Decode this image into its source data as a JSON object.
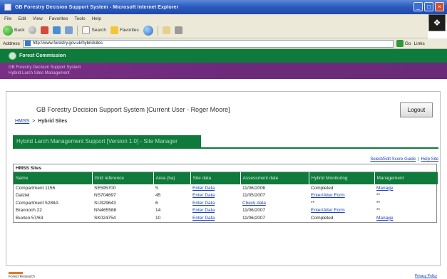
{
  "window": {
    "title": "GB Forestry Decision Support System - Microsoft Internet Explorer",
    "controls": [
      "_",
      "□",
      "×"
    ]
  },
  "menu": [
    "File",
    "Edit",
    "View",
    "Favorites",
    "Tools",
    "Help"
  ],
  "toolbar": {
    "back_label": "Back",
    "search_label": "Search",
    "favorites_label": "Favorites"
  },
  "address": {
    "label": "Address",
    "url": "http://www.forestry.gov.uk/hybridsites",
    "go_label": "Go",
    "links_label": "Links"
  },
  "site": {
    "brand": "Forest Commission",
    "sub_line_1": "GB Forestry Decision Support System",
    "sub_line_2": "Hybrid Larch Sites Management"
  },
  "page": {
    "system_title": "GB Forestry Decision Support System [Current User - Roger Moore]",
    "logout_label": "Logout",
    "breadcrumb_home": "HMSS",
    "breadcrumb_sep": ">",
    "breadcrumb_current": "Hybrid Sites",
    "section_tab": "Hybrid Larch Management Support [Version 1.0] - Site Manager",
    "top_link_1": "Select/Edit Score Guide",
    "top_link_sep": "|",
    "top_link_2": "Help Site"
  },
  "table": {
    "caption": "HMSS Sites",
    "headers": [
      "Name",
      "Grid reference",
      "Area (ha)",
      "Site data",
      "Assessment date",
      "Hybrid Monitoring",
      "Management"
    ],
    "rows": [
      [
        "Compartment 1156",
        "SE595700",
        "5",
        "Enter Data",
        "11/06/2006",
        "Completed",
        "Manage"
      ],
      [
        "Dalziel",
        "NS704697",
        "45",
        "Enter Data",
        "11/05/2007",
        "Enter/Alter Form",
        "**"
      ],
      [
        "Compartment 5288A",
        "SU329643",
        "6",
        "Enter Data",
        "Check data",
        "**",
        "**"
      ],
      [
        "Brannoch 22",
        "NN465588",
        "14",
        "Enter Data",
        "11/06/2007",
        "Enter/Alter Form",
        "**"
      ],
      [
        "Buxton 57/63",
        "SK024754",
        "10",
        "Enter Data",
        "11/06/2007",
        "Completed",
        "Manage"
      ]
    ]
  },
  "footer": {
    "brand": "Forest Research",
    "right_link": "Privacy Policy"
  }
}
